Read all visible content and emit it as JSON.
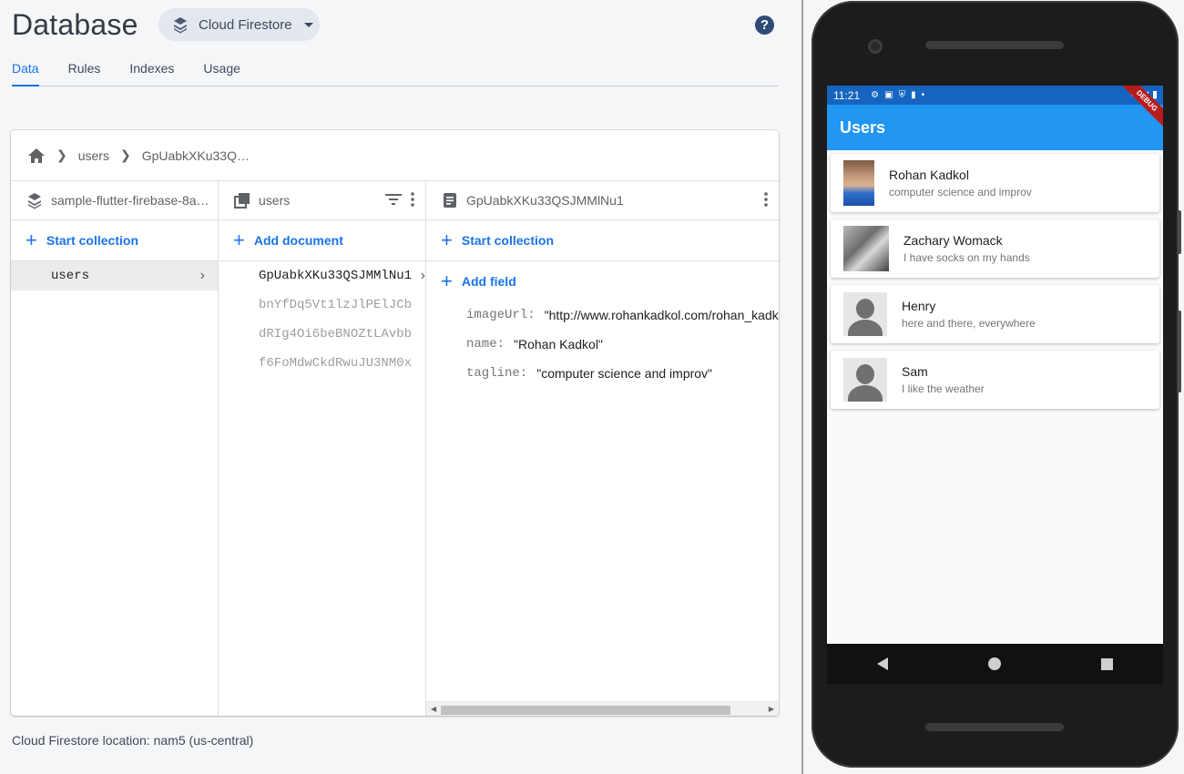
{
  "console": {
    "title": "Database",
    "db_selector": "Cloud Firestore",
    "help": "?",
    "tabs": [
      {
        "label": "Data"
      },
      {
        "label": "Rules"
      },
      {
        "label": "Indexes"
      },
      {
        "label": "Usage"
      }
    ],
    "breadcrumb": {
      "segments": [
        "users",
        "GpUabkXKu33Q…"
      ]
    },
    "root_column": {
      "header": "sample-flutter-firebase-8a…",
      "action": "Start collection",
      "items": [
        {
          "label": "users"
        }
      ]
    },
    "collection_column": {
      "header": "users",
      "action": "Add document",
      "documents": [
        {
          "id": "GpUabkXKu33QSJMMlNu1"
        },
        {
          "id": "bnYfDq5Vt1lzJlPElJCb"
        },
        {
          "id": "dRIg4Oi6beBNOZtLAvbb"
        },
        {
          "id": "f6FoMdwCkdRwuJU3NM0x"
        }
      ]
    },
    "document_column": {
      "header": "GpUabkXKu33QSJMMlNu1",
      "collection_action": "Start collection",
      "field_action": "Add field",
      "fields": [
        {
          "key": "imageUrl:",
          "value": "\"http://www.rohankadkol.com/rohan_kadk"
        },
        {
          "key": "name:",
          "value": "\"Rohan Kadkol\""
        },
        {
          "key": "tagline:",
          "value": "\"computer science and improv\""
        }
      ]
    },
    "location": "Cloud Firestore location: nam5 (us-central)",
    "accent_color": "#1a73e8"
  },
  "phone": {
    "status_time": "11:21",
    "debug_banner": "DEBUG",
    "app_title": "Users",
    "appbar_color": "#2196f3",
    "users": [
      {
        "name": "Rohan Kadkol",
        "tagline": "computer science and improv",
        "avatar": "photo"
      },
      {
        "name": "Zachary Womack",
        "tagline": "I have socks on my hands",
        "avatar": "photo"
      },
      {
        "name": "Henry",
        "tagline": "here and there, everywhere",
        "avatar": "generic"
      },
      {
        "name": "Sam",
        "tagline": "I like the weather",
        "avatar": "generic"
      }
    ]
  }
}
